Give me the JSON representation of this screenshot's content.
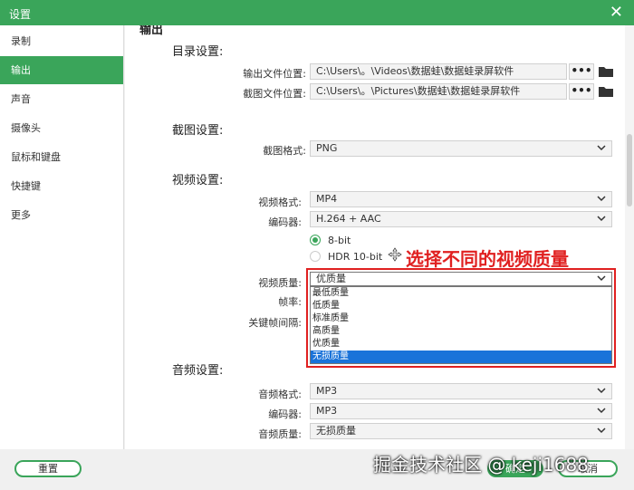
{
  "window": {
    "title": "设置"
  },
  "sidebar": {
    "items": [
      {
        "label": "录制"
      },
      {
        "label": "输出"
      },
      {
        "label": "声音"
      },
      {
        "label": "摄像头"
      },
      {
        "label": "鼠标和键盘"
      },
      {
        "label": "快捷键"
      },
      {
        "label": "更多"
      }
    ]
  },
  "main": {
    "header_partial": "输出",
    "directory": {
      "title": "目录设置:",
      "output_label": "输出文件位置:",
      "output_path": "C:\\Users\\。\\Videos\\数据蛙\\数据蛙录屏软件",
      "screenshot_label": "截图文件位置:",
      "screenshot_path": "C:\\Users\\。\\Pictures\\数据蛙\\数据蛙录屏软件",
      "browse_label": "•••"
    },
    "screenshot": {
      "title": "截图设置:",
      "format_label": "截图格式:",
      "format_value": "PNG"
    },
    "video": {
      "title": "视频设置:",
      "format_label": "视频格式:",
      "format_value": "MP4",
      "encoder_label": "编码器:",
      "encoder_value": "H.264 + AAC",
      "bit8": "8-bit",
      "hdr": "HDR 10-bit",
      "quality_label": "视频质量:",
      "quality_value": "优质量",
      "fps_label": "帧率:",
      "keyframe_label": "关键帧间隔:",
      "quality_options": [
        "最低质量",
        "低质量",
        "标准质量",
        "高质量",
        "优质量",
        "无损质量"
      ],
      "selected_option": "无损质量",
      "annotation": "选择不同的视频质量"
    },
    "audio": {
      "title": "音频设置:",
      "format_label": "音频格式:",
      "format_value": "MP3",
      "encoder_label": "编码器:",
      "encoder_value": "MP3",
      "quality_label": "音频质量:",
      "quality_value": "无损质量"
    }
  },
  "footer": {
    "reset": "重置",
    "ok": "确定",
    "cancel": "取消"
  },
  "watermark": "掘金技术社区 @ keji1688",
  "colors": {
    "accent": "#3aa55a",
    "highlight": "#1a73d9",
    "annotation": "#e02020"
  }
}
